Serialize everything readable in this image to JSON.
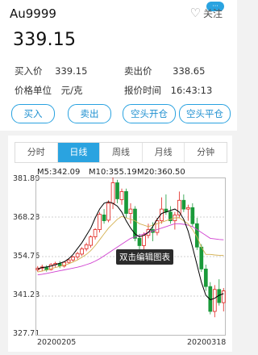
{
  "quote": {
    "symbol": "Au9999",
    "favorite_label": "关注",
    "badge_label": "···",
    "price": "339.15",
    "fields": [
      {
        "label": "买入价",
        "value": "339.15"
      },
      {
        "label": "卖出价",
        "value": "338.65"
      },
      {
        "label": "价格单位",
        "value": "元/克"
      },
      {
        "label": "报价时间",
        "value": "16:43:13"
      }
    ]
  },
  "actions": [
    "买入",
    "卖出",
    "空头开仓",
    "空头平仓"
  ],
  "tabs": [
    {
      "label": "分时",
      "active": false
    },
    {
      "label": "日线",
      "active": true
    },
    {
      "label": "周线",
      "active": false
    },
    {
      "label": "月线",
      "active": false
    },
    {
      "label": "分钟",
      "active": false
    }
  ],
  "ma_labels": [
    "M5:342.09",
    "M10:355.19",
    "M20:360.50"
  ],
  "tooltip": "双击编辑图表",
  "colors": {
    "accent": "#2aa3e0",
    "up": "#e0201a",
    "down": "#1a9a3a",
    "ma5": "#000000",
    "ma10": "#d4b050",
    "ma20": "#d040d0"
  },
  "chart_data": {
    "type": "candlestick",
    "ylim": [
      327.71,
      381.8
    ],
    "y_ticks": [
      "381.80",
      "368.28",
      "354.76",
      "341.23",
      "327.71"
    ],
    "x_ticks": [
      "20200205",
      "20200318"
    ],
    "candles": [
      [
        350.2,
        351.5,
        349.5,
        350.8
      ],
      [
        350.8,
        352.0,
        349.8,
        351.2
      ],
      [
        351.0,
        351.8,
        349.6,
        350.2
      ],
      [
        350.3,
        352.5,
        350.0,
        352.0
      ],
      [
        352.0,
        353.0,
        351.0,
        352.4
      ],
      [
        352.4,
        353.2,
        350.8,
        351.6
      ],
      [
        351.5,
        353.0,
        351.0,
        352.8
      ],
      [
        352.8,
        354.0,
        352.2,
        353.6
      ],
      [
        353.6,
        355.0,
        353.0,
        354.6
      ],
      [
        354.6,
        356.4,
        353.8,
        355.8
      ],
      [
        355.6,
        358.0,
        355.0,
        357.4
      ],
      [
        357.4,
        359.5,
        356.6,
        358.8
      ],
      [
        358.6,
        362.0,
        357.8,
        361.5
      ],
      [
        361.5,
        364.5,
        360.6,
        364.0
      ],
      [
        364.0,
        370.0,
        363.0,
        369.2
      ],
      [
        369.0,
        371.0,
        366.0,
        367.0
      ],
      [
        367.2,
        374.0,
        366.5,
        373.0
      ],
      [
        373.0,
        382.0,
        371.0,
        380.0
      ],
      [
        380.0,
        381.0,
        373.0,
        374.5
      ],
      [
        374.2,
        378.0,
        372.5,
        377.0
      ],
      [
        377.0,
        378.0,
        368.0,
        369.5
      ],
      [
        369.5,
        373.0,
        366.0,
        371.0
      ],
      [
        371.0,
        372.0,
        360.0,
        361.0
      ],
      [
        361.0,
        362.5,
        356.5,
        358.5
      ],
      [
        358.5,
        363.0,
        357.0,
        362.0
      ],
      [
        362.0,
        366.0,
        361.0,
        364.0
      ],
      [
        364.0,
        366.5,
        360.0,
        363.0
      ],
      [
        363.0,
        368.0,
        362.0,
        367.0
      ],
      [
        367.0,
        375.0,
        366.0,
        371.0
      ],
      [
        371.0,
        376.0,
        369.0,
        370.0
      ],
      [
        370.0,
        372.0,
        366.0,
        367.0
      ],
      [
        367.0,
        370.0,
        364.0,
        369.0
      ],
      [
        369.0,
        377.0,
        368.0,
        374.0
      ],
      [
        374.0,
        376.0,
        370.0,
        371.0
      ],
      [
        371.0,
        372.5,
        367.0,
        371.5
      ],
      [
        371.5,
        373.0,
        365.0,
        366.0
      ],
      [
        366.0,
        368.0,
        357.0,
        358.0
      ],
      [
        358.0,
        359.0,
        349.5,
        350.5
      ],
      [
        350.5,
        352.0,
        343.0,
        344.5
      ],
      [
        344.5,
        346.0,
        335.0,
        336.0
      ],
      [
        336.0,
        345.0,
        334.0,
        343.5
      ],
      [
        343.5,
        347.0,
        338.0,
        339.0
      ],
      [
        339.0,
        344.0,
        336.0,
        343.0
      ]
    ],
    "ma5": [
      350.5,
      351.0,
      351.2,
      351.5,
      352.0,
      352.5,
      353.0,
      354.0,
      355.5,
      357.5,
      359.5,
      362.0,
      364.5,
      368.0,
      371.0,
      373.0,
      373.5,
      373.0,
      372.0,
      370.0,
      367.0,
      364.5,
      362.5,
      361.5,
      362.0,
      363.0,
      365.0,
      367.5,
      369.5,
      370.0,
      370.5,
      371.0,
      370.0,
      367.5,
      363.5,
      358.0,
      352.0,
      346.0,
      341.5,
      340.0,
      340.5,
      341.5,
      342.1
    ],
    "ma10": [
      349.5,
      349.8,
      350.2,
      350.6,
      351.0,
      351.4,
      351.8,
      352.3,
      352.9,
      353.6,
      354.5,
      355.5,
      356.8,
      358.5,
      360.5,
      362.5,
      364.5,
      366.0,
      367.5,
      368.5,
      368.0,
      367.5,
      367.0,
      366.0,
      365.5,
      365.0,
      365.5,
      366.0,
      366.5,
      367.0,
      367.5,
      368.0,
      368.0,
      367.0,
      366.0,
      364.0,
      361.5,
      358.0,
      355.5,
      355.5,
      355.3,
      355.2,
      355.2
    ],
    "ma20": [
      348.5,
      348.7,
      349.0,
      349.3,
      349.6,
      349.9,
      350.2,
      350.5,
      350.8,
      351.1,
      351.5,
      352.0,
      352.5,
      353.2,
      354.0,
      355.0,
      356.0,
      357.0,
      358.0,
      359.0,
      360.0,
      361.0,
      361.5,
      362.0,
      362.5,
      363.0,
      363.5,
      364.0,
      364.5,
      365.0,
      365.5,
      366.0,
      366.0,
      365.8,
      365.5,
      365.0,
      364.0,
      363.0,
      362.0,
      361.0,
      360.8,
      360.6,
      360.5
    ]
  }
}
